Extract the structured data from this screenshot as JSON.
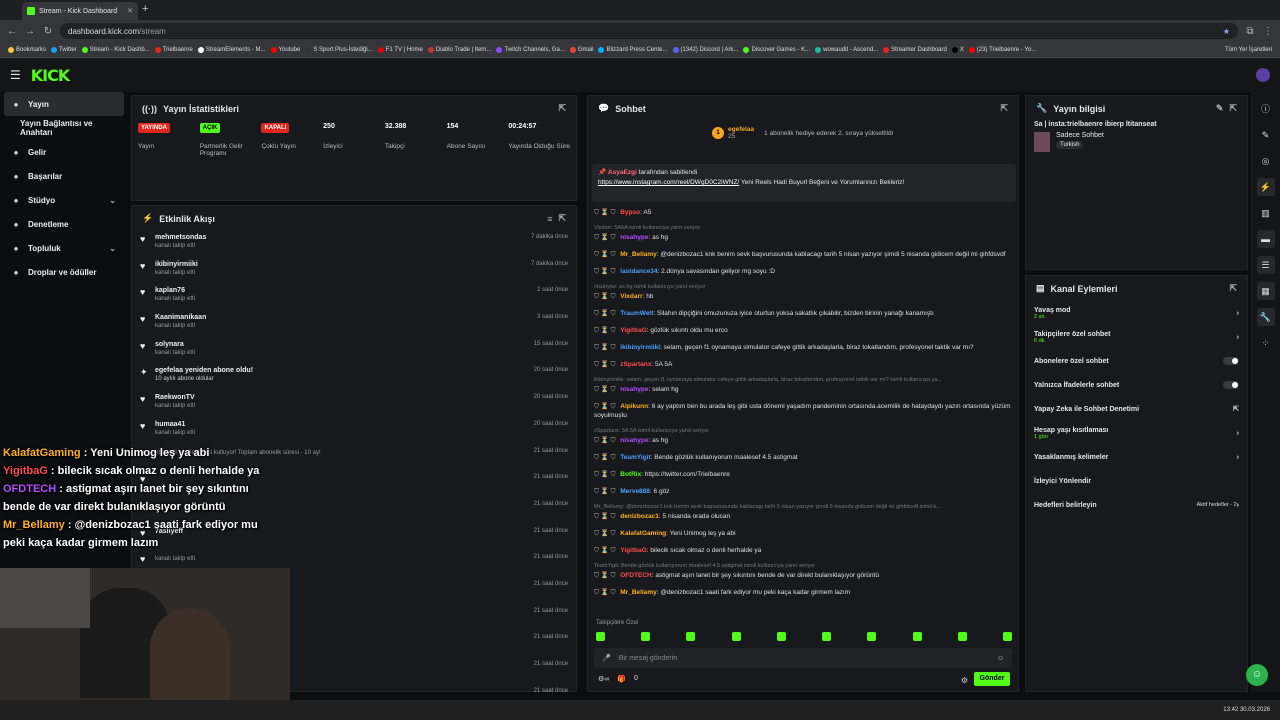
{
  "browser": {
    "tab_title": "Stream - Kick Dashboard",
    "url_host": "dashboard.kick.com",
    "url_path": "/stream",
    "bookmarks": [
      "Bookmarks",
      "Twitter",
      "Stream - Kick Dashb...",
      "Trielbaenre",
      "StreamElements - M...",
      "Youtube",
      "S Sport Plus-İstediği...",
      "F1 TV | Home",
      "Diablo Trade | Item...",
      "Twitch Channels, Ga...",
      "Gmail",
      "Blizzard Press Cente...",
      "(1342) Discord | Ark...",
      "Discover Games - K...",
      "wowaudit - Ascend...",
      "Streamer Dashboard",
      "X",
      "(23) Trielbaenre - Yo..."
    ],
    "bookmarks_all": "Tüm Yer İşaretleri"
  },
  "sidebar": {
    "items": [
      {
        "label": "Yayın",
        "icon": "broadcast-icon"
      },
      {
        "label": "Yayın Bağlantısı ve Anahtarı",
        "icon": ""
      },
      {
        "label": "Gelir",
        "icon": "money-icon"
      },
      {
        "label": "Başarılar",
        "icon": "trophy-icon"
      },
      {
        "label": "Stüdyo",
        "icon": "studio-icon"
      },
      {
        "label": "Denetleme",
        "icon": "shield-icon"
      },
      {
        "label": "Topluluk",
        "icon": "people-icon"
      },
      {
        "label": "Droplar ve ödüller",
        "icon": "gift-icon"
      }
    ]
  },
  "stats": {
    "title": "Yayın İstatistikleri",
    "items": [
      {
        "badge": "YAYINDA",
        "label": "Yayın"
      },
      {
        "badge": "AÇIK",
        "label": "Partnerlik Gelir Programı"
      },
      {
        "badge": "KAPALI",
        "label": "Çoklu Yayın"
      },
      {
        "value": "250",
        "label": "İzleyici"
      },
      {
        "value": "32.388",
        "label": "Takipçi"
      },
      {
        "value": "154",
        "label": "Abone Sayısı"
      },
      {
        "value": "00:24:57",
        "label": "Yayında Olduğu Süre"
      }
    ]
  },
  "events": {
    "title": "Etkinlik Akışı",
    "items": [
      {
        "user": "mehmetsondas",
        "desc": "kanalı takip etti",
        "time": "7 dakika önce"
      },
      {
        "user": "ikibinyirmiiki",
        "desc": "kanalı takip etti",
        "time": "7 dakika önce"
      },
      {
        "user": "kaplan76",
        "desc": "kanalı takip etti",
        "time": "2 saat önce"
      },
      {
        "user": "Kaanimanikaan",
        "desc": "kanalı takip etti",
        "time": "3 saat önce"
      },
      {
        "user": "solynara",
        "desc": "kanalı takip etti",
        "time": "15 saat önce"
      },
      {
        "user": "egefelaa yeniden abone oldu!",
        "desc": "10 aylık abone oldular",
        "time": "20 saat önce"
      },
      {
        "user": "RaekwonTV",
        "desc": "kanalı takip etti",
        "time": "20 saat önce"
      },
      {
        "user": "humaa41",
        "desc": "kanalı takip etti",
        "time": "20 saat önce"
      },
      {
        "user": "",
        "desc": "abonelik yenilemesini kutluyor! Toplam abonelik süresi - 10 ay!",
        "time": "21 saat önce"
      },
      {
        "user": "",
        "desc": "",
        "time": "21 saat önce"
      },
      {
        "user": "",
        "desc": "",
        "time": "21 saat önce"
      },
      {
        "user": "7asliyeff",
        "desc": "",
        "time": "21 saat önce"
      },
      {
        "user": "",
        "desc": "kanalı takip etti",
        "time": "21 saat önce"
      },
      {
        "user": "",
        "desc": "",
        "time": "21 saat önce"
      },
      {
        "user": "",
        "desc": "",
        "time": "21 saat önce"
      },
      {
        "user": "",
        "desc": "",
        "time": "21 saat önce"
      },
      {
        "user": "",
        "desc": "",
        "time": "21 saat önce"
      },
      {
        "user": "",
        "desc": "",
        "time": "21 saat önce"
      }
    ]
  },
  "chat": {
    "title": "Sohbet",
    "top_user": "egefelaa",
    "top_count": "25",
    "top_text": "1 abonelik hediye ederek 2. sıraya yükseltildi",
    "pinned_by": "AsyaEzgi",
    "pinned_suffix": "tarafından sabitlendi",
    "pinned_link": "https://www.instagram.com/reel/DWgD0C2iWNZ/",
    "pinned_text": "Yeni Reels Hadi Buyurl Beğeni ve Yorumlarınızı Bekleriz!",
    "messages": [
      {
        "user": "Bypso",
        "color": "#ff4d4d",
        "text": "A5"
      },
      {
        "reply": "Vixdarr: 5A5A isimli kullanıcıya yanıt veriyor",
        "user": "nisahype",
        "color": "#b04dff",
        "text": "as hg"
      },
      {
        "user": "Mr_Bellamy",
        "color": "#ffb020",
        "text": "@denizbozac1 knk benim sevk başvurusunda kablacagı tarih 5 nisan yazıyor şimdi 5 nisanda gidicem değil mi gihfdsvdf"
      },
      {
        "user": "lastdance34",
        "color": "#4d9fff",
        "text": "2.dünya savasından geliyor mg soyu :D"
      },
      {
        "reply": "nisahype: as hg isimli kullanıcıya yanıt veriyor",
        "user": "Vixdarr",
        "color": "#ffb020",
        "text": "hb"
      },
      {
        "user": "TraumWelt",
        "color": "#4d9fff",
        "text": "Silahın dipçiğini omuzunuza iyice oturtun yoksa sakatlık çıkabilir, bizden birinin yanağı kanamıştı"
      },
      {
        "user": "YigitbaG",
        "color": "#ff4d4d",
        "text": "gözlük sıkıntı oldu mu erco"
      },
      {
        "user": "ikibinyirmiiki",
        "color": "#4d9fff",
        "text": "selam, geçen f1 oynamaya simulator cafeye gittik arkadaşlarla, biraz tokatlandım, profesyonel taktik var mı?"
      },
      {
        "user": "zSpartanx",
        "color": "#ff4d4d",
        "text": "5A 5A"
      },
      {
        "reply": "ikibinyirmiiki: selam, geçen f1 oynamaya simulator cafeye gittik arkadaşlarla, biraz tokatlandım, profesyonel taktik var mı? isimli kullanıcıya ya...",
        "user": "nisahype",
        "color": "#b04dff",
        "text": "selam hg"
      },
      {
        "user": "Alpikunn",
        "color": "#ffb020",
        "text": "6 ay yaptım ben bu arada leş gibi usta dönemi yaşadım pandeminin ortasında.acemilik de hataydaydı yazın ortasında yüzüm soyulmuştu"
      },
      {
        "reply": "zSpartanx: 5A 5A isimli kullanıcıya yanıt veriyor",
        "user": "nisahype",
        "color": "#b04dff",
        "text": "as hg"
      },
      {
        "user": "TeamYigit",
        "color": "#4d9fff",
        "text": "Bende gözlük kullanıyorum maalesef 4.5 astigmat"
      },
      {
        "user": "BotRix",
        "color": "#53fc18",
        "text": "https://twitter.com/Trielbaenre"
      },
      {
        "user": "Merve888",
        "color": "#4d9fff",
        "text": "6 göz"
      },
      {
        "reply": "Mr_Bellamy: @denizbozac1 knk benim sevk başvurusunda kablacagı tarih 5 nisan yazıyor şimdi 5 nisanda gidicem değil mi gihfdsvdf isimli k...",
        "user": "denizbozac1",
        "color": "#ffb020",
        "text": "5 nisanda orada olucan"
      },
      {
        "user": "KalafatGaming",
        "color": "#ffb020",
        "text": "Yeni Unimog leş ya abi"
      },
      {
        "user": "YigitbaG",
        "color": "#ff4d4d",
        "text": "bilecik sıcak olmaz o denli herhalde ya"
      },
      {
        "reply": "TeamYigit: Bende gözlük kullanıyorum maalesef 4.5 astigmat isimli kullanıcıya yanıt veriyor",
        "user": "OFDTECH",
        "color": "#ff4d4d",
        "text": "astigmat aşırı lanet bir şey sıkıntını bende de var direkt bulanıklaşıyor görüntü"
      },
      {
        "user": "Mr_Bellamy",
        "color": "#ffb020",
        "text": "@denizbozac1 saati fark ediyor mu peki kaça kadar girmem lazım"
      }
    ],
    "followers_only": "Takipçilere Özel",
    "placeholder": "Bir mesaj gönderin",
    "counter": "0",
    "send": "Gönder"
  },
  "info": {
    "title": "Yayın bilgisi",
    "stream_title": "Sa | insta:trielbaenre ibierp ltitanseat",
    "category": "Sadece Sohbet",
    "tag": "Turkish"
  },
  "actions": {
    "title": "Kanal Eylemleri",
    "items": [
      {
        "label": "Yavaş mod",
        "sub": "2 sn.",
        "ctl": "chevron"
      },
      {
        "label": "Takipçilere özel sohbet",
        "sub": "6 dk.",
        "ctl": "chevron"
      },
      {
        "label": "Abonelere özel sohbet",
        "sub": "",
        "ctl": "toggle"
      },
      {
        "label": "Yalnızca İfadelerle sohbet",
        "sub": "",
        "ctl": "toggle"
      },
      {
        "label": "Yapay Zeka ile Sohbet Denetimi",
        "sub": "",
        "ctl": "ext"
      },
      {
        "label": "Hesap yaşı kısıtlaması",
        "sub": "1 gün",
        "ctl": "chevron"
      },
      {
        "label": "Yasaklanmış kelimeler",
        "sub": "",
        "ctl": "chevron"
      },
      {
        "label": "İzleyici Yönlendir",
        "sub": "",
        "ctl": "none"
      },
      {
        "label": "Hedefleri belirleyin",
        "sub": "",
        "ctl": "goal",
        "extra": "Aktif hedefler - 2"
      }
    ]
  },
  "overlay": {
    "lines": [
      {
        "user": "KalafatGaming",
        "color": "#ffb020",
        "text": "Yeni Unimog leş ya abi"
      },
      {
        "user": "YigitbaG",
        "color": "#ff4d4d",
        "text": "bilecik sıcak olmaz o denli herhalde ya"
      },
      {
        "user": "OFDTECH",
        "color": "#b04dff",
        "text": "astigmat aşırı lanet bir şey sıkıntını"
      },
      {
        "user": "",
        "color": "",
        "text": "bende de var direkt bulanıklaşıyor görüntü"
      },
      {
        "user": "Mr_Bellamy",
        "color": "#ffb020",
        "text": "@denizbozac1 saati fark ediyor mu"
      },
      {
        "user": "",
        "color": "",
        "text": "peki kaça kadar girmem lazım"
      }
    ]
  },
  "taskbar": {
    "time": "13:42",
    "date": "30.03.2026"
  }
}
